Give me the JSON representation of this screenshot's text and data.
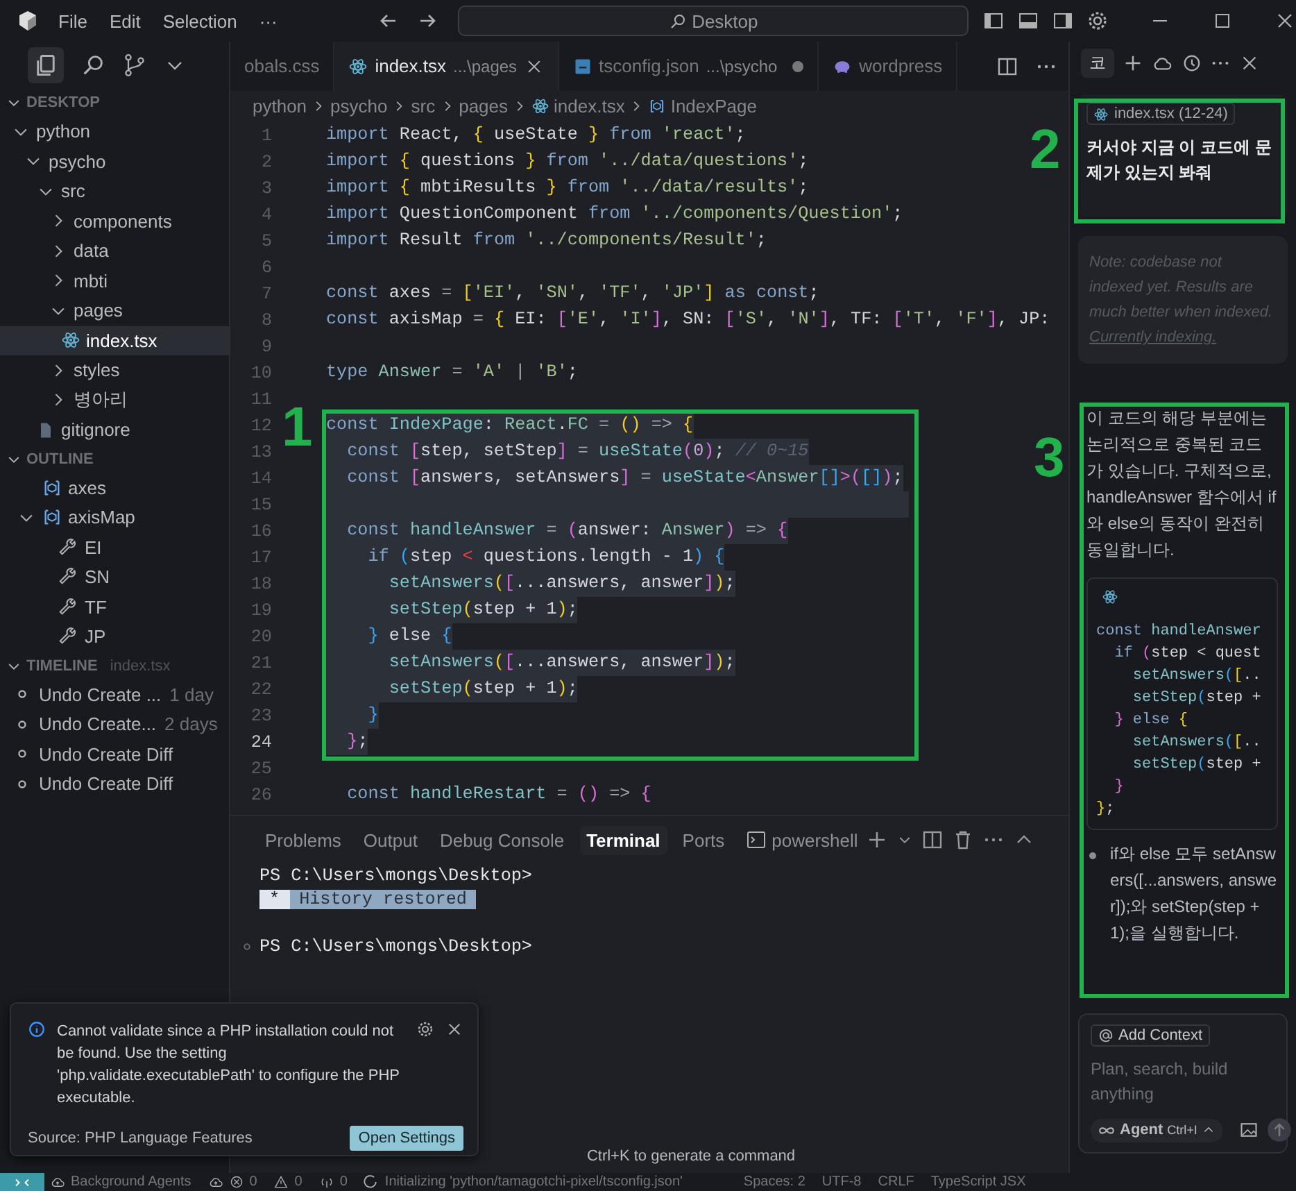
{
  "title_bar": {
    "menu": [
      "File",
      "Edit",
      "Selection",
      "···"
    ],
    "search": "Desktop"
  },
  "sidebar": {
    "section": "DESKTOP",
    "tree": [
      {
        "label": "python",
        "kind": "folder",
        "expanded": true,
        "selected": false,
        "children": [
          {
            "label": "psycho",
            "kind": "folder",
            "expanded": true,
            "selected": false,
            "children": [
              {
                "label": "src",
                "kind": "folder",
                "expanded": true,
                "selected": false,
                "children": [
                  {
                    "label": "components",
                    "kind": "folder",
                    "expanded": false,
                    "selected": false
                  },
                  {
                    "label": "data",
                    "kind": "folder",
                    "expanded": false,
                    "selected": false
                  },
                  {
                    "label": "mbti",
                    "kind": "folder",
                    "expanded": false,
                    "selected": false
                  },
                  {
                    "label": "pages",
                    "kind": "folder",
                    "expanded": true,
                    "selected": false,
                    "children": [
                      {
                        "label": "index.tsx",
                        "kind": "react",
                        "selected": true
                      }
                    ]
                  },
                  {
                    "label": "styles",
                    "kind": "folder",
                    "expanded": false,
                    "selected": false
                  },
                  {
                    "label": "병아리",
                    "kind": "folder",
                    "expanded": false,
                    "selected": false
                  }
                ]
              },
              {
                "label": "gitignore",
                "kind": "file",
                "selected": false
              }
            ]
          }
        ]
      }
    ],
    "outline": {
      "title": "OUTLINE",
      "items": [
        {
          "label": "axes",
          "kind": "variable"
        },
        {
          "label": "axisMap",
          "kind": "variable",
          "expanded": true,
          "children": [
            {
              "label": "EI",
              "kind": "property"
            },
            {
              "label": "SN",
              "kind": "property"
            },
            {
              "label": "TF",
              "kind": "property"
            },
            {
              "label": "JP",
              "kind": "property"
            }
          ]
        }
      ]
    },
    "timeline": {
      "title": "TIMELINE",
      "file": "index.tsx",
      "items": [
        {
          "label": "Undo Create ...",
          "age": "1 day"
        },
        {
          "label": "Undo Create...",
          "age": "2 days"
        },
        {
          "label": "Undo Create Diff"
        },
        {
          "label": "Undo Create Diff"
        }
      ]
    }
  },
  "editor": {
    "tabs": [
      {
        "label": "obals.css",
        "kind": "css",
        "selected": false,
        "modified": false
      },
      {
        "label": "index.tsx",
        "path": "...\\pages",
        "kind": "react",
        "selected": true,
        "modified": false
      },
      {
        "label": "tsconfig.json",
        "path": "...\\psycho",
        "kind": "ts",
        "selected": false,
        "modified": true
      },
      {
        "label": "wordpress",
        "kind": "php",
        "selected": false,
        "modified": false
      }
    ],
    "breadcrumb": [
      {
        "label": "python"
      },
      {
        "label": "psycho"
      },
      {
        "label": "src"
      },
      {
        "label": "pages"
      },
      {
        "label": "index.tsx",
        "kind": "react"
      },
      {
        "label": "IndexPage",
        "kind": "symbol"
      }
    ],
    "lines": [
      {
        "n": "1",
        "selected": false,
        "current": false,
        "tokens": [
          {
            "kind": "k",
            "text": "import"
          },
          {
            "kind": "p",
            "text": " React, "
          },
          {
            "kind": "y",
            "text": "{"
          },
          {
            "kind": "p",
            "text": " useState "
          },
          {
            "kind": "y",
            "text": "}"
          },
          {
            "kind": "k",
            "text": " from "
          },
          {
            "kind": "s",
            "text": "'react'"
          },
          {
            "kind": "p",
            "text": ";"
          }
        ]
      },
      {
        "n": "2",
        "selected": false,
        "current": false,
        "tokens": [
          {
            "kind": "k",
            "text": "import "
          },
          {
            "kind": "y",
            "text": "{"
          },
          {
            "kind": "p",
            "text": " questions "
          },
          {
            "kind": "y",
            "text": "}"
          },
          {
            "kind": "k",
            "text": " from "
          },
          {
            "kind": "s",
            "text": "'../data/questions'"
          },
          {
            "kind": "p",
            "text": ";"
          }
        ]
      },
      {
        "n": "3",
        "selected": false,
        "current": false,
        "tokens": [
          {
            "kind": "k",
            "text": "import "
          },
          {
            "kind": "y",
            "text": "{"
          },
          {
            "kind": "p",
            "text": " mbtiResults "
          },
          {
            "kind": "y",
            "text": "}"
          },
          {
            "kind": "k",
            "text": " from "
          },
          {
            "kind": "s",
            "text": "'../data/results'"
          },
          {
            "kind": "p",
            "text": ";"
          }
        ]
      },
      {
        "n": "4",
        "selected": false,
        "current": false,
        "tokens": [
          {
            "kind": "k",
            "text": "import"
          },
          {
            "kind": "p",
            "text": " QuestionComponent "
          },
          {
            "kind": "k",
            "text": "from "
          },
          {
            "kind": "s",
            "text": "'../components/Question'"
          },
          {
            "kind": "p",
            "text": ";"
          }
        ]
      },
      {
        "n": "5",
        "selected": false,
        "current": false,
        "tokens": [
          {
            "kind": "k",
            "text": "import"
          },
          {
            "kind": "p",
            "text": " Result "
          },
          {
            "kind": "k",
            "text": "from "
          },
          {
            "kind": "s",
            "text": "'../components/Result'"
          },
          {
            "kind": "p",
            "text": ";"
          }
        ]
      },
      {
        "n": "6",
        "selected": false,
        "current": false
      },
      {
        "n": "7",
        "selected": false,
        "current": false,
        "tokens": [
          {
            "kind": "k",
            "text": "const"
          },
          {
            "kind": "p",
            "text": " axes "
          },
          {
            "kind": "o",
            "text": "= "
          },
          {
            "kind": "y",
            "text": "["
          },
          {
            "kind": "s",
            "text": "'EI'"
          },
          {
            "kind": "p",
            "text": ", "
          },
          {
            "kind": "s",
            "text": "'SN'"
          },
          {
            "kind": "p",
            "text": ", "
          },
          {
            "kind": "s",
            "text": "'TF'"
          },
          {
            "kind": "p",
            "text": ", "
          },
          {
            "kind": "s",
            "text": "'JP'"
          },
          {
            "kind": "y",
            "text": "]"
          },
          {
            "kind": "k",
            "text": " as const"
          },
          {
            "kind": "p",
            "text": ";"
          }
        ]
      },
      {
        "n": "8",
        "selected": false,
        "current": false,
        "tokens": [
          {
            "kind": "k",
            "text": "const"
          },
          {
            "kind": "p",
            "text": " axisMap "
          },
          {
            "kind": "o",
            "text": "= "
          },
          {
            "kind": "y",
            "text": "{"
          },
          {
            "kind": "p",
            "text": " EI: "
          },
          {
            "kind": "m",
            "text": "["
          },
          {
            "kind": "s",
            "text": "'E'"
          },
          {
            "kind": "p",
            "text": ", "
          },
          {
            "kind": "s",
            "text": "'I'"
          },
          {
            "kind": "m",
            "text": "]"
          },
          {
            "kind": "p",
            "text": ", SN: "
          },
          {
            "kind": "m",
            "text": "["
          },
          {
            "kind": "s",
            "text": "'S'"
          },
          {
            "kind": "p",
            "text": ", "
          },
          {
            "kind": "s",
            "text": "'N'"
          },
          {
            "kind": "m",
            "text": "]"
          },
          {
            "kind": "p",
            "text": ", TF: "
          },
          {
            "kind": "m",
            "text": "["
          },
          {
            "kind": "s",
            "text": "'T'"
          },
          {
            "kind": "p",
            "text": ", "
          },
          {
            "kind": "s",
            "text": "'F'"
          },
          {
            "kind": "m",
            "text": "]"
          },
          {
            "kind": "p",
            "text": ", JP:"
          }
        ]
      },
      {
        "n": "9",
        "selected": false,
        "current": false
      },
      {
        "n": "10",
        "selected": false,
        "current": false,
        "tokens": [
          {
            "kind": "k",
            "text": "type "
          },
          {
            "kind": "g",
            "text": "Answer"
          },
          {
            "kind": "o",
            "text": " = "
          },
          {
            "kind": "s",
            "text": "'A'"
          },
          {
            "kind": "o",
            "text": " | "
          },
          {
            "kind": "s",
            "text": "'B'"
          },
          {
            "kind": "p",
            "text": ";"
          }
        ]
      },
      {
        "n": "11",
        "selected": false,
        "current": false
      },
      {
        "n": "12",
        "selected": true,
        "current": false,
        "tokens": [
          {
            "kind": "k",
            "text": "const "
          },
          {
            "kind": "t",
            "text": "IndexPage"
          },
          {
            "kind": "p",
            "text": ": "
          },
          {
            "kind": "g",
            "text": "React"
          },
          {
            "kind": "p",
            "text": "."
          },
          {
            "kind": "g",
            "text": "FC"
          },
          {
            "kind": "o",
            "text": " = "
          },
          {
            "kind": "y",
            "text": "()"
          },
          {
            "kind": "o",
            "text": " => "
          },
          {
            "kind": "y",
            "text": "{"
          }
        ]
      },
      {
        "n": "13",
        "selected": true,
        "current": false,
        "tokens": [
          {
            "kind": "k",
            "text": "  const "
          },
          {
            "kind": "m",
            "text": "["
          },
          {
            "kind": "p",
            "text": "step, setStep"
          },
          {
            "kind": "m",
            "text": "]"
          },
          {
            "kind": "o",
            "text": " = "
          },
          {
            "kind": "t",
            "text": "useState"
          },
          {
            "kind": "m",
            "text": "("
          },
          {
            "kind": "n",
            "text": "0"
          },
          {
            "kind": "m",
            "text": ")"
          },
          {
            "kind": "p",
            "text": "; "
          },
          {
            "kind": "c",
            "text": "// 0~15"
          }
        ]
      },
      {
        "n": "14",
        "selected": true,
        "current": false,
        "tokens": [
          {
            "kind": "k",
            "text": "  const "
          },
          {
            "kind": "m",
            "text": "["
          },
          {
            "kind": "p",
            "text": "answers, setAnswers"
          },
          {
            "kind": "m",
            "text": "]"
          },
          {
            "kind": "o",
            "text": " = "
          },
          {
            "kind": "t",
            "text": "useState"
          },
          {
            "kind": "m",
            "text": "<"
          },
          {
            "kind": "g",
            "text": "Answer"
          },
          {
            "kind": "b",
            "text": "[]"
          },
          {
            "kind": "m",
            "text": ">("
          },
          {
            "kind": "b",
            "text": "[]"
          },
          {
            "kind": "m",
            "text": ")"
          },
          {
            "kind": "p",
            "text": ";"
          }
        ]
      },
      {
        "n": "15",
        "selected": true,
        "current": false
      },
      {
        "n": "16",
        "selected": true,
        "current": false,
        "tokens": [
          {
            "kind": "k",
            "text": "  const "
          },
          {
            "kind": "t",
            "text": "handleAnswer"
          },
          {
            "kind": "o",
            "text": " = "
          },
          {
            "kind": "m",
            "text": "("
          },
          {
            "kind": "p",
            "text": "answer: "
          },
          {
            "kind": "g",
            "text": "Answer"
          },
          {
            "kind": "m",
            "text": ")"
          },
          {
            "kind": "o",
            "text": " => "
          },
          {
            "kind": "m",
            "text": "{"
          }
        ]
      },
      {
        "n": "17",
        "selected": true,
        "current": false,
        "tokens": [
          {
            "kind": "k",
            "text": "    if "
          },
          {
            "kind": "b",
            "text": "("
          },
          {
            "kind": "p",
            "text": "step "
          },
          {
            "kind": "r",
            "text": "<"
          },
          {
            "kind": "p",
            "text": " questions.length - 1"
          },
          {
            "kind": "b",
            "text": ")"
          },
          {
            "kind": "b",
            "text": " {"
          }
        ]
      },
      {
        "n": "18",
        "selected": true,
        "current": false,
        "tokens": [
          {
            "kind": "t",
            "text": "      setAnswers"
          },
          {
            "kind": "y",
            "text": "("
          },
          {
            "kind": "m",
            "text": "["
          },
          {
            "kind": "p",
            "text": "...answers, answer"
          },
          {
            "kind": "m",
            "text": "]"
          },
          {
            "kind": "y",
            "text": ")"
          },
          {
            "kind": "p",
            "text": ";"
          }
        ]
      },
      {
        "n": "19",
        "selected": true,
        "current": false,
        "tokens": [
          {
            "kind": "t",
            "text": "      setStep"
          },
          {
            "kind": "y",
            "text": "("
          },
          {
            "kind": "p",
            "text": "step + 1"
          },
          {
            "kind": "y",
            "text": ")"
          },
          {
            "kind": "p",
            "text": ";"
          }
        ]
      },
      {
        "n": "20",
        "selected": true,
        "current": false,
        "tokens": [
          {
            "kind": "b",
            "text": "    }"
          },
          {
            "kind": "p",
            "text": " else "
          },
          {
            "kind": "b",
            "text": "{"
          }
        ]
      },
      {
        "n": "21",
        "selected": true,
        "current": false,
        "tokens": [
          {
            "kind": "t",
            "text": "      setAnswers"
          },
          {
            "kind": "y",
            "text": "("
          },
          {
            "kind": "m",
            "text": "["
          },
          {
            "kind": "p",
            "text": "...answers, answer"
          },
          {
            "kind": "m",
            "text": "]"
          },
          {
            "kind": "y",
            "text": ")"
          },
          {
            "kind": "p",
            "text": ";"
          }
        ]
      },
      {
        "n": "22",
        "selected": true,
        "current": false,
        "tokens": [
          {
            "kind": "t",
            "text": "      setStep"
          },
          {
            "kind": "y",
            "text": "("
          },
          {
            "kind": "p",
            "text": "step + 1"
          },
          {
            "kind": "y",
            "text": ")"
          },
          {
            "kind": "p",
            "text": ";"
          }
        ]
      },
      {
        "n": "23",
        "selected": true,
        "current": false,
        "tokens": [
          {
            "kind": "b",
            "text": "    }"
          }
        ]
      },
      {
        "n": "24",
        "selected": true,
        "current": true,
        "tokens": [
          {
            "kind": "m",
            "text": "  }"
          },
          {
            "kind": "p",
            "text": ";"
          }
        ]
      },
      {
        "n": "25",
        "selected": false,
        "current": false
      },
      {
        "n": "26",
        "selected": false,
        "current": false,
        "tokens": [
          {
            "kind": "k",
            "text": "  const "
          },
          {
            "kind": "t",
            "text": "handleRestart"
          },
          {
            "kind": "o",
            "text": " = "
          },
          {
            "kind": "m",
            "text": "()"
          },
          {
            "kind": "o",
            "text": " => "
          },
          {
            "kind": "m",
            "text": "{"
          }
        ]
      }
    ]
  },
  "panel": {
    "tabs": [
      {
        "label": "Problems",
        "selected": false
      },
      {
        "label": "Output",
        "selected": false
      },
      {
        "label": "Debug Console",
        "selected": false
      },
      {
        "label": "Terminal",
        "selected": true
      },
      {
        "label": "Ports",
        "selected": false
      }
    ],
    "shell": "powershell",
    "lines": [
      {
        "kind": "prompt",
        "text": "PS C:\\Users\\mongs\\Desktop>"
      },
      {
        "kind": "highlight",
        "mark": "*",
        "text": "History restored"
      },
      {
        "kind": "blank"
      },
      {
        "kind": "prompt-dot",
        "text": "PS C:\\Users\\mongs\\Desktop>"
      }
    ],
    "hint": "Ctrl+K to generate a command"
  },
  "notification": {
    "message": "Cannot validate since a PHP installation could not be found. Use the setting 'php.validate.executablePath' to configure the PHP executable.",
    "source": "Source: PHP Language Features",
    "action": "Open Settings"
  },
  "chat": {
    "tab": "코",
    "request": {
      "chip": "index.tsx (12-24)",
      "text": "커서야 지금 이 코드에 문제가 있는지 봐줘"
    },
    "note": {
      "text": "Note: codebase not indexed yet. Results are much better when indexed.",
      "link": "Currently indexing."
    },
    "response": {
      "text": "이 코드의 해당 부분에는 논리적으로 중복된 코드가 있습니다. 구체적으로, handleAnswer 함수에서 if와 else의 동작이 완전히 동일합니다.",
      "code": [
        [
          {
            "kind": "k",
            "text": "const "
          },
          {
            "kind": "t",
            "text": "handleAnswer"
          }
        ],
        [
          {
            "kind": "k",
            "text": "  if "
          },
          {
            "kind": "m",
            "text": "("
          },
          {
            "kind": "p",
            "text": "step < quest"
          }
        ],
        [
          {
            "kind": "t",
            "text": "    setAnswers"
          },
          {
            "kind": "b",
            "text": "("
          },
          {
            "kind": "y",
            "text": "["
          },
          {
            "kind": "p",
            "text": ".."
          }
        ],
        [
          {
            "kind": "t",
            "text": "    setStep"
          },
          {
            "kind": "b",
            "text": "("
          },
          {
            "kind": "p",
            "text": "step +"
          }
        ],
        [
          {
            "kind": "m",
            "text": "  }"
          },
          {
            "kind": "k",
            "text": " else "
          },
          {
            "kind": "y",
            "text": "{"
          }
        ],
        [
          {
            "kind": "t",
            "text": "    setAnswers"
          },
          {
            "kind": "b",
            "text": "("
          },
          {
            "kind": "y",
            "text": "["
          },
          {
            "kind": "p",
            "text": ".."
          }
        ],
        [
          {
            "kind": "t",
            "text": "    setStep"
          },
          {
            "kind": "b",
            "text": "("
          },
          {
            "kind": "p",
            "text": "step +"
          }
        ],
        [
          {
            "kind": "m",
            "text": "  }"
          }
        ],
        [
          {
            "kind": "y",
            "text": "}"
          },
          {
            "kind": "p",
            "text": ";"
          }
        ]
      ],
      "bullet": "if와 else 모두 setAnswers([...answers, answer]);와 setStep(step + 1);을 실행합니다."
    },
    "input": {
      "context": "Add Context",
      "placeholder": "Plan, search, build anything",
      "mode": "Agent",
      "shortcut": "Ctrl+I"
    }
  },
  "annotations": [
    {
      "label": "1"
    },
    {
      "label": "2"
    },
    {
      "label": "3"
    }
  ],
  "status_bar": {
    "items": [
      {
        "kind": "remote"
      },
      {
        "kind": "agents",
        "text": "Background Agents"
      },
      {
        "kind": "sync"
      },
      {
        "kind": "errors",
        "text": "0"
      },
      {
        "kind": "warnings",
        "text": "0"
      },
      {
        "kind": "ports",
        "text": "0"
      },
      {
        "kind": "loading",
        "text": "Initializing 'python/tamagotchi-pixel/tsconfig.json'"
      },
      {
        "kind": "plain",
        "text": "Spaces: 2"
      },
      {
        "kind": "plain",
        "text": "UTF-8"
      },
      {
        "kind": "plain",
        "text": "CRLF"
      },
      {
        "kind": "plain",
        "text": "TypeScript JSX"
      }
    ]
  }
}
